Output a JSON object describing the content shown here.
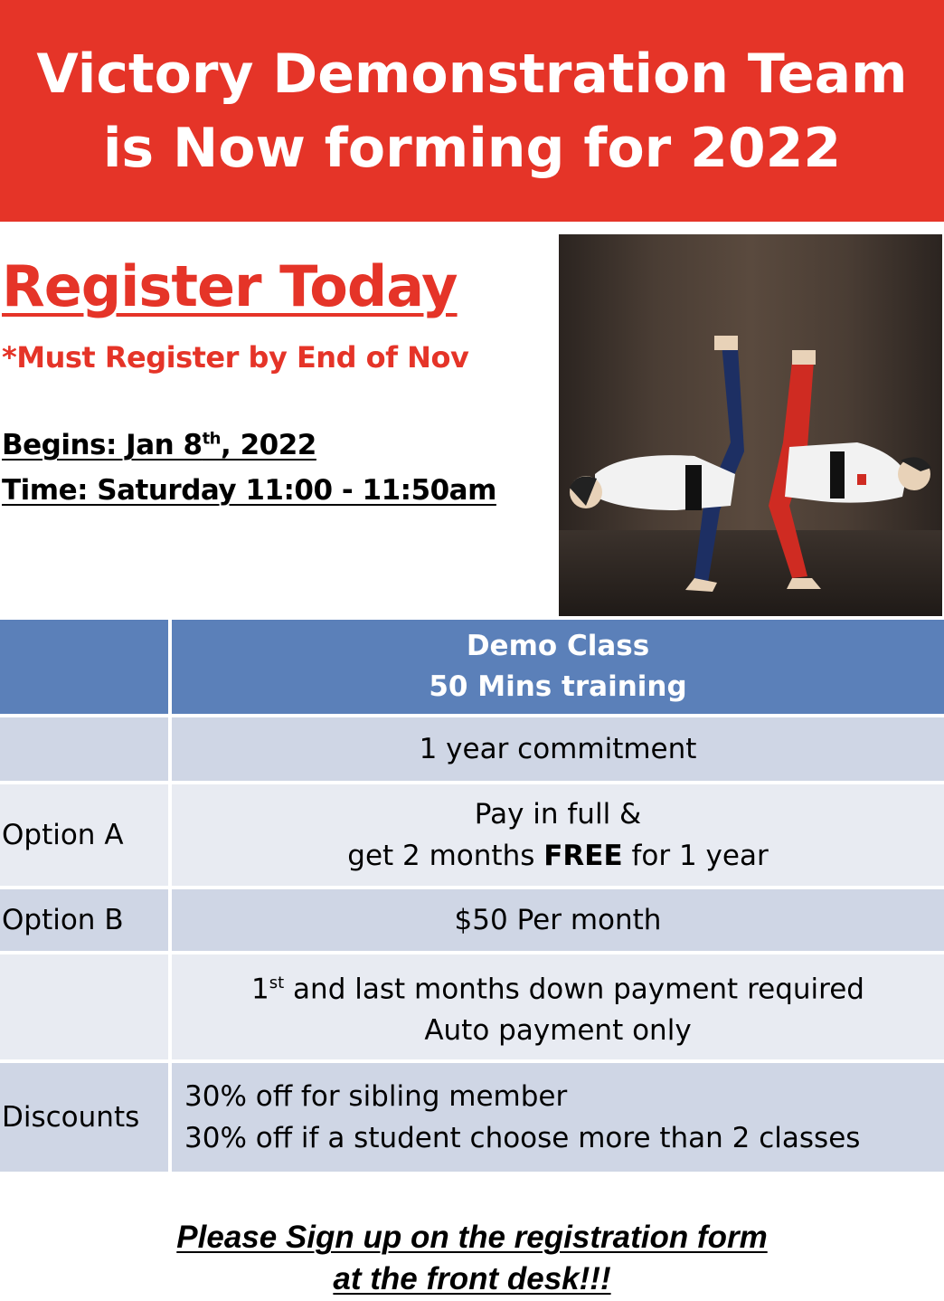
{
  "header": {
    "line1": "Victory Demonstration Team",
    "line2": "is Now forming for 2022"
  },
  "register": {
    "title": "Register Today",
    "deadline": "*Must Register by End of Nov",
    "begins_prefix": "Begins: Jan 8",
    "begins_sup": "th",
    "begins_suffix": ", 2022",
    "time": "Time: Saturday 11:00 - 11:50am"
  },
  "table": {
    "header_line1": "Demo Class",
    "header_line2": "50 Mins training",
    "commitment": "1 year commitment",
    "option_a_label": "Option A",
    "option_a_line1": "Pay in full &",
    "option_a_line2_pre": "get 2 months ",
    "option_a_line2_bold": "FREE",
    "option_a_line2_post": " for 1 year",
    "option_b_label": "Option B",
    "option_b_value": "$50 Per month",
    "payment_num": "1",
    "payment_sup": "st",
    "payment_rest": " and last months down payment required",
    "payment_line2": "Auto payment only",
    "discounts_label": "Discounts",
    "discount_1": "30% off for sibling member",
    "discount_2": "30% off if a student choose more than 2 classes"
  },
  "footer": {
    "line1": "Please Sign up on the registration form",
    "line2": "at the front desk!!!"
  },
  "colors": {
    "banner_red": "#e53428",
    "table_header_blue": "#5b80b9",
    "row_dark": "#cfd6e5",
    "row_light": "#e8ebf2"
  }
}
